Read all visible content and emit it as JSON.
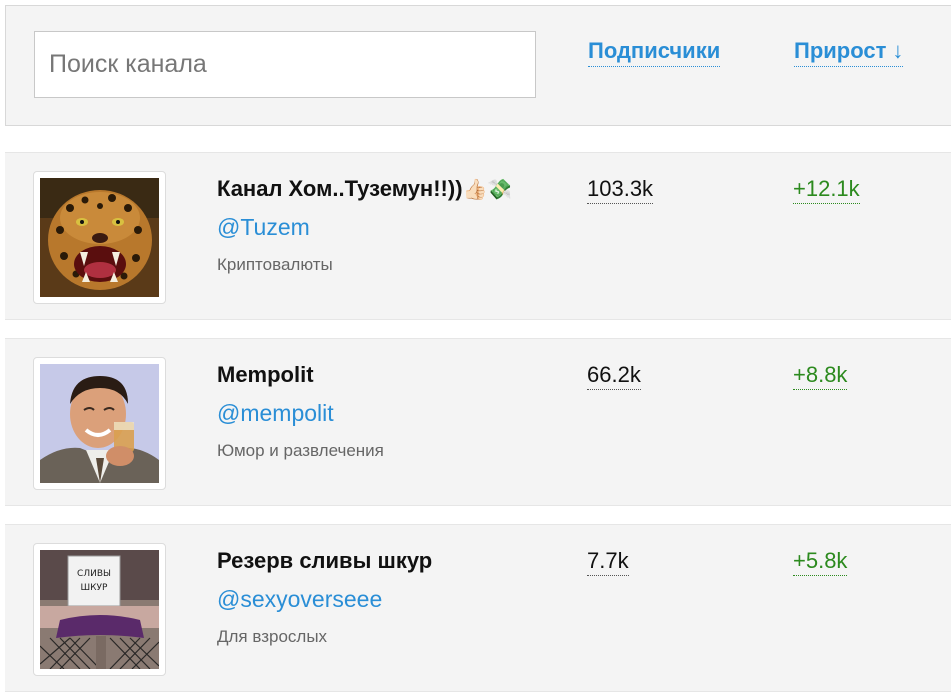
{
  "search": {
    "placeholder": "Поиск канала",
    "value": ""
  },
  "columns": {
    "subscribers_label": "Подписчики",
    "growth_label": "Прирост",
    "growth_sort_arrow": "↓"
  },
  "channels": [
    {
      "title": "Канал Хом..Туземун!!))",
      "title_emoji": "👍🏻💸",
      "handle": "@Tuzem",
      "category": "Криптовалюты",
      "subscribers": "103.3k",
      "growth": "+12.1k",
      "avatar": "leopard-avatar"
    },
    {
      "title": "Mempolit",
      "title_emoji": "",
      "handle": "@mempolit",
      "category": "Юмор и развлечения",
      "subscribers": "66.2k",
      "growth": "+8.8k",
      "avatar": "man-drinking-avatar"
    },
    {
      "title": "Резерв сливы шкур",
      "title_emoji": "",
      "handle": "@sexyoverseee",
      "category": "Для взрослых",
      "subscribers": "7.7k",
      "growth": "+5.8k",
      "avatar": "sign-photo-avatar",
      "avatar_sign_text": [
        "СЛИВЫ",
        "ШКУР"
      ]
    }
  ],
  "colors": {
    "link_blue": "#2a8ed6",
    "growth_green": "#2c8a1e",
    "panel_bg": "#f4f4f4"
  }
}
